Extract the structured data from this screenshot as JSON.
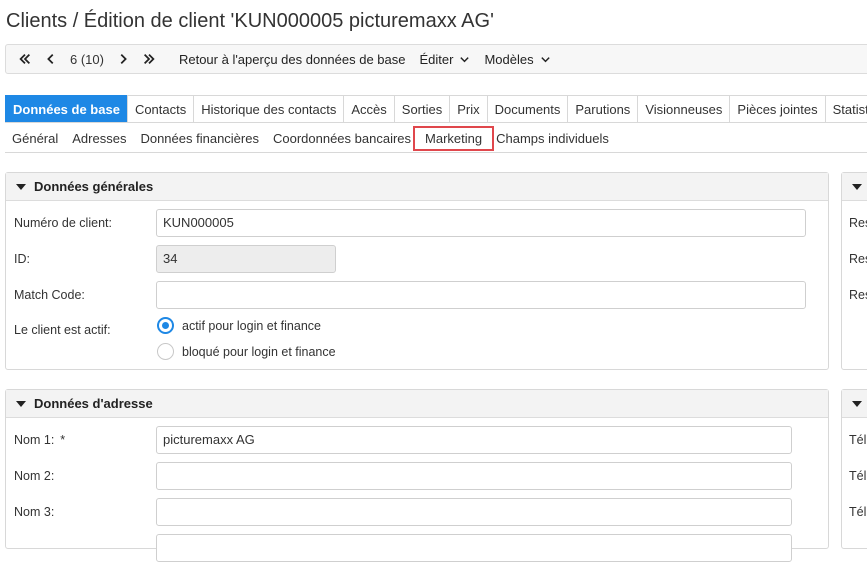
{
  "page": {
    "title": "Clients / Édition de client 'KUN000005 picturemaxx AG'"
  },
  "toolbar": {
    "position": "6 (10)",
    "back_label": "Retour à l'aperçu des données de base",
    "edit_label": "Éditer",
    "templates_label": "Modèles"
  },
  "tabs": [
    "Données de base",
    "Contacts",
    "Historique des contacts",
    "Accès",
    "Sorties",
    "Prix",
    "Documents",
    "Parutions",
    "Visionneuses",
    "Pièces jointes",
    "Statistiques"
  ],
  "subtabs": [
    "Général",
    "Adresses",
    "Données financières",
    "Coordonnées bancaires",
    "Marketing",
    "Champs individuels"
  ],
  "general": {
    "heading": "Données générales",
    "client_number_label": "Numéro de client:",
    "client_number_value": "KUN000005",
    "id_label": "ID:",
    "id_value": "34",
    "match_code_label": "Match Code:",
    "match_code_value": "",
    "active_label": "Le client est actif:",
    "active_option": "actif pour login et finance",
    "blocked_option": "bloqué pour login et finance"
  },
  "address": {
    "heading": "Données d'adresse",
    "name1_label": "Nom 1:",
    "name1_required": "*",
    "name1_value": "picturemaxx AG",
    "name2_label": "Nom 2:",
    "name2_value": "",
    "name3_label": "Nom 3:",
    "name3_value": ""
  },
  "right_panel": {
    "labels_top": [
      "Res",
      "Res",
      "Res"
    ],
    "labels_bottom": [
      "Tél",
      "Tél",
      "Tél"
    ]
  },
  "colors": {
    "accent": "#1e88e5",
    "highlight": "#e0474c"
  }
}
